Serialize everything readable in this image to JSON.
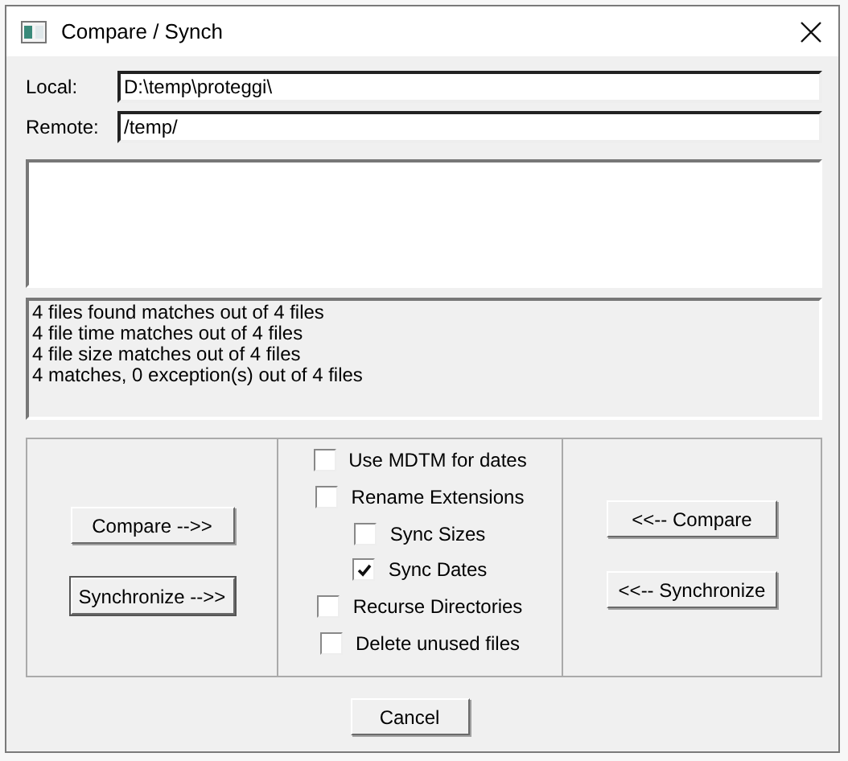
{
  "window": {
    "title": "Compare / Synch"
  },
  "fields": [
    {
      "label": "Local:",
      "value": "D:\\temp\\proteggi\\"
    },
    {
      "label": "Remote:",
      "value": "/temp/"
    }
  ],
  "status_lines": [
    "4 files found matches out of 4 files",
    "4 file time matches out of 4 files",
    "4 file size matches out of 4 files",
    "4 matches, 0 exception(s) out of 4 files"
  ],
  "left_buttons": [
    "Compare -->>",
    "Synchronize -->>"
  ],
  "options": [
    {
      "label": "Use MDTM for dates",
      "checked": false
    },
    {
      "label": "Rename Extensions",
      "checked": false
    },
    {
      "label": "Sync Sizes",
      "checked": false
    },
    {
      "label": "Sync Dates",
      "checked": true
    },
    {
      "label": "Recurse Directories",
      "checked": false
    },
    {
      "label": "Delete unused files",
      "checked": false
    }
  ],
  "right_buttons": [
    "<<-- Compare",
    "<<-- Synchronize"
  ],
  "cancel_button": "Cancel"
}
